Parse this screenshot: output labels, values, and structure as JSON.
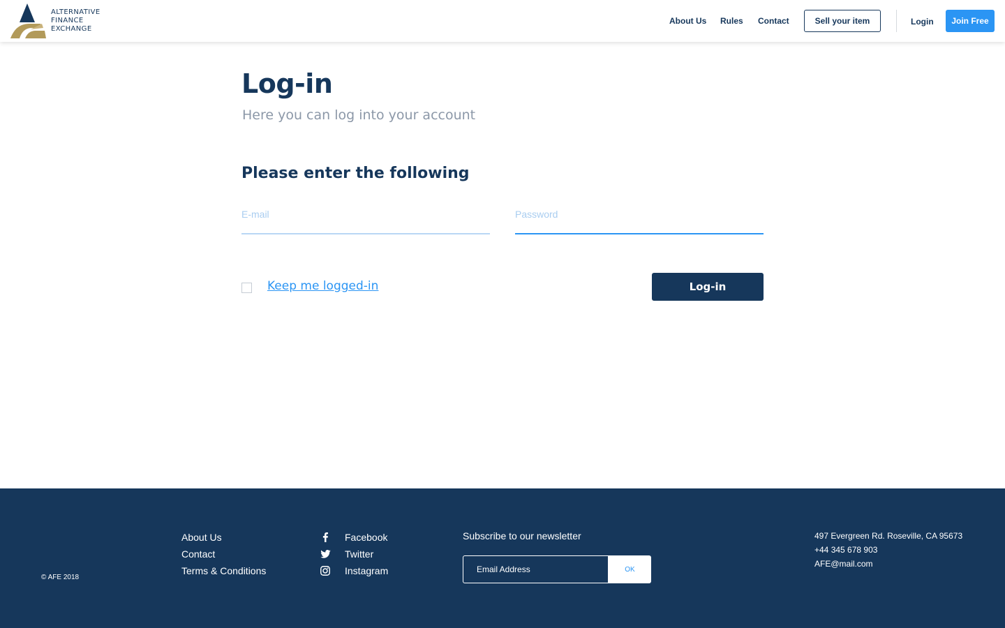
{
  "header": {
    "logo": {
      "line1": "ALTERNATIVE",
      "line2": "FINANCE",
      "line3": "EXCHANGE"
    },
    "nav": {
      "about": "About Us",
      "rules": "Rules",
      "contact": "Contact",
      "sell": "Sell your item",
      "login": "Login",
      "join": "Join Free"
    }
  },
  "main": {
    "title": "Log-in",
    "subtitle": "Here you can log into your account",
    "section_heading": "Please enter the following",
    "email_placeholder": "E-mail",
    "password_placeholder": "Password",
    "email_value": "",
    "password_value": "",
    "keep_logged_in": "Keep me logged-in",
    "keep_logged_in_checked": false,
    "submit": "Log-in"
  },
  "footer": {
    "copyright": "© AFE 2018",
    "links": [
      "About Us",
      "Contact",
      "Terms & Conditions"
    ],
    "social": [
      {
        "icon": "facebook-icon",
        "label": "Facebook"
      },
      {
        "icon": "twitter-icon",
        "label": "Twitter"
      },
      {
        "icon": "instagram-icon",
        "label": "Instagram"
      }
    ],
    "newsletter": {
      "title": "Subscribe to our newsletter",
      "placeholder": "Email Address",
      "button": "OK"
    },
    "contact": {
      "address": "497 Evergreen Rd. Roseville, CA 95673",
      "phone": "+44 345 678 903",
      "email": "AFE@mail.com"
    }
  },
  "colors": {
    "navy": "#16375b",
    "accent_blue": "#2b95f4",
    "gold": "#b29a5a",
    "muted_text": "#8c98a8"
  }
}
